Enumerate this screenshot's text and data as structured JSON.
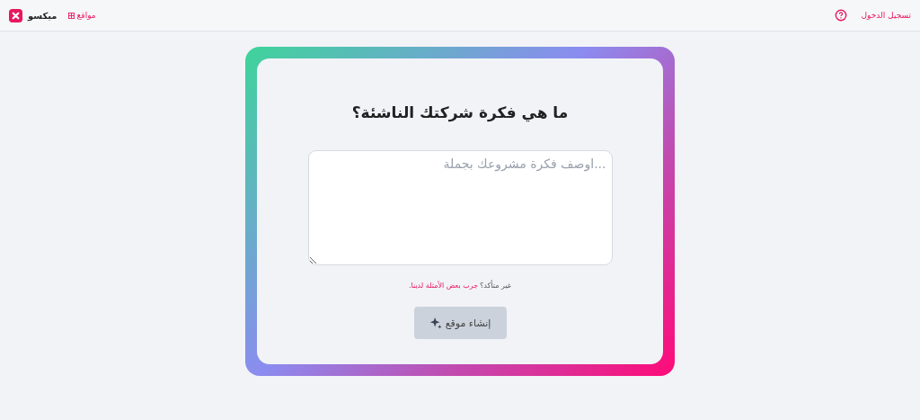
{
  "header": {
    "brand": "ميكسو",
    "sites_link": "مواقع",
    "login_link": "تسجيل الدخول"
  },
  "card": {
    "title": "ما هي فكرة شركتك الناشئة؟",
    "idea_field": {
      "placeholder": "...اوصف فكرة مشروعك بجملة"
    },
    "hint": {
      "text": "غير متأكد؟",
      "link": "جرب بعض الأمثلة لدينا."
    },
    "create_button": {
      "label": "إنشاء موقع",
      "disabled": true
    }
  }
}
